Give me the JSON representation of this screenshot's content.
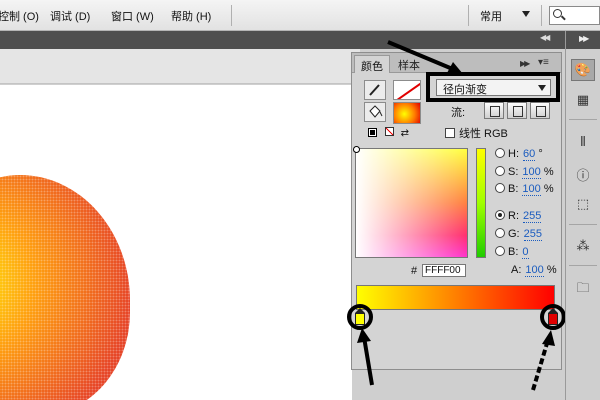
{
  "menubar": {
    "items": [
      "控制 (O)",
      "调试 (D)",
      "窗口 (W)",
      "帮助 (H)"
    ],
    "workspace": "常用"
  },
  "panel": {
    "tabs": [
      "颜色",
      "样本"
    ],
    "gradient_type": "径向渐变",
    "flow_label": "流:",
    "linear_rgb_label": "线性 RGB",
    "hsb": [
      {
        "label": "H:",
        "value": "60",
        "unit": "°"
      },
      {
        "label": "S:",
        "value": "100",
        "unit": "%"
      },
      {
        "label": "B:",
        "value": "100",
        "unit": "%"
      }
    ],
    "rgb": [
      {
        "label": "R:",
        "value": "255"
      },
      {
        "label": "G:",
        "value": "255"
      },
      {
        "label": "B:",
        "value": "0"
      }
    ],
    "hex_label": "#",
    "hex_value": "FFFF00",
    "alpha_label": "A:",
    "alpha_value": "100",
    "alpha_unit": "%"
  },
  "colors": {
    "gradient_start": "#ffff00",
    "gradient_end": "#ff0000",
    "stop_left": "#ffff00",
    "stop_right": "#e00000"
  }
}
